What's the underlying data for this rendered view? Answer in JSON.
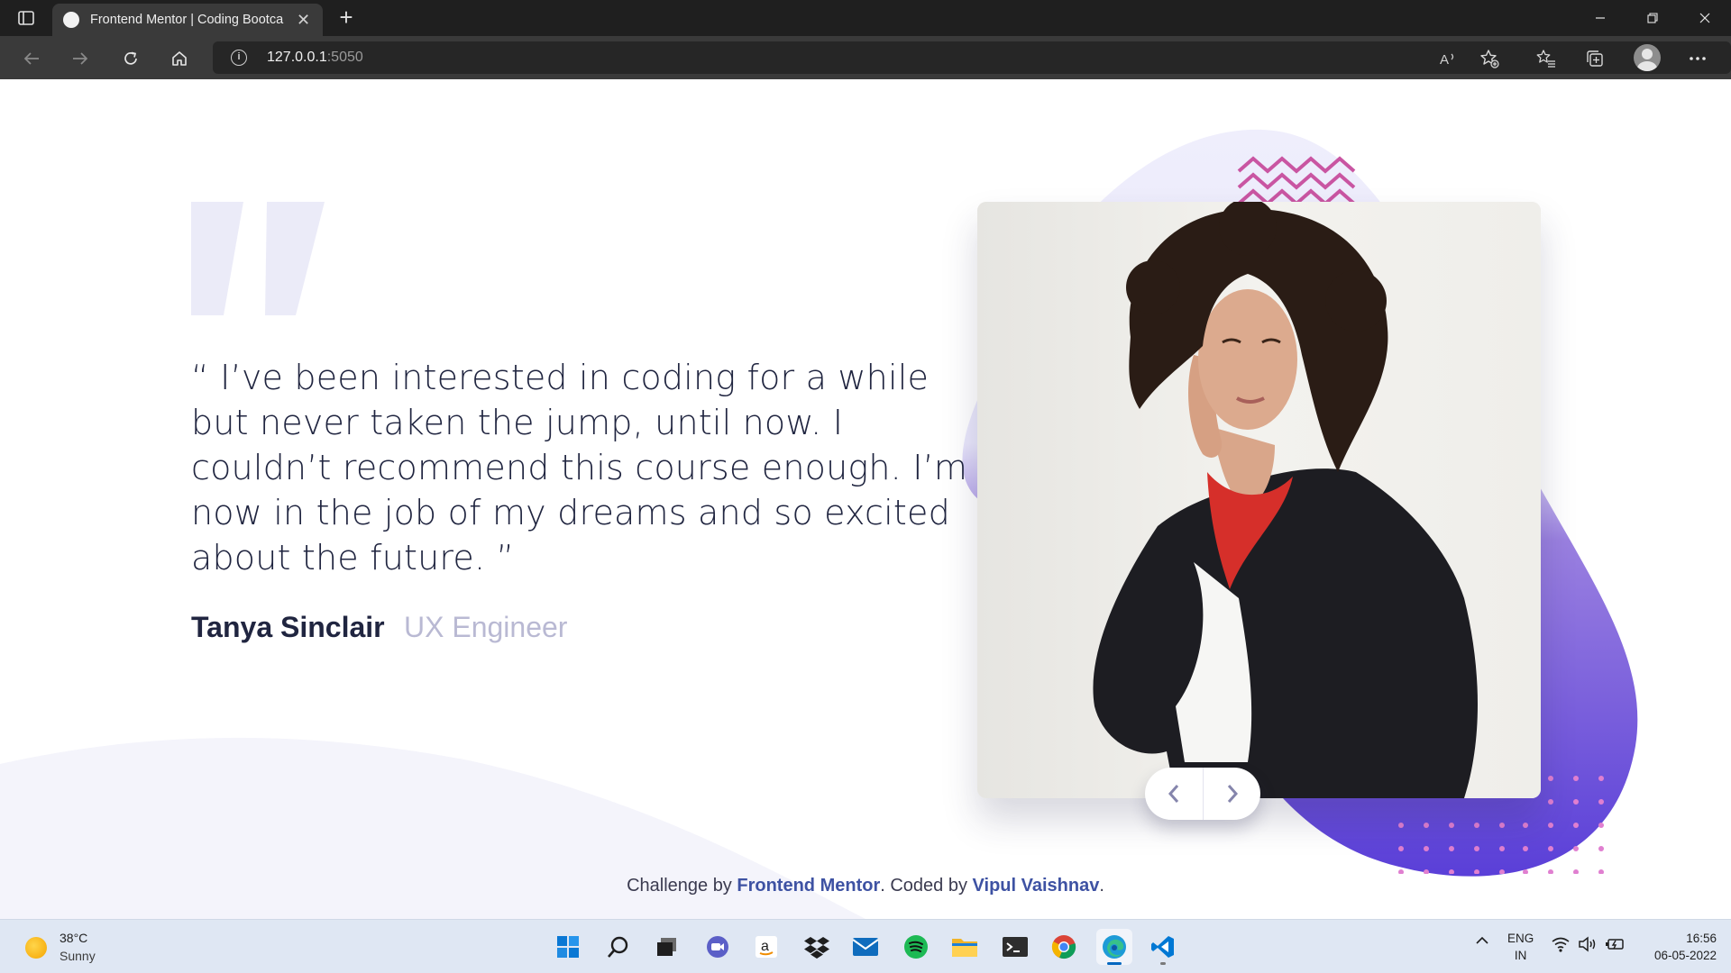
{
  "browser": {
    "tab_title": "Frontend Mentor | Coding Bootcamp Testimonials Slider",
    "address_host": "127.0.0.1",
    "address_port": ":5050"
  },
  "testimonial": {
    "quote": "“ I’ve been interested in coding for a while but never taken the jump, until now. I couldn’t recommend this course enough. I’m now in the job of my dreams and so excited about the future. ”",
    "author_name": "Tanya Sinclair",
    "author_role": "UX Engineer"
  },
  "attribution": {
    "prefix": "Challenge by ",
    "challenge_link": "Frontend Mentor",
    "middle": ". Coded by ",
    "coder_link": "Vipul Vaishnav",
    "suffix": "."
  },
  "colors": {
    "dark_navy": "#202540",
    "grayish_blue": "#b9b9d3",
    "accent_purple": "#6e5bd6",
    "zigzag_pink": "#c955a2",
    "link_blue": "#3e52a3"
  },
  "taskbar": {
    "weather_temp": "38°C",
    "weather_condition": "Sunny",
    "apps": [
      "start-icon",
      "search-icon",
      "task-view-icon",
      "teams-chat-icon",
      "amazon-icon",
      "dropbox-icon",
      "mail-icon",
      "spotify-icon",
      "file-explorer-icon",
      "terminal-icon",
      "chrome-icon",
      "edge-icon",
      "vscode-icon"
    ],
    "lang_1": "ENG",
    "lang_2": "IN",
    "time": "16:56",
    "date": "06-05-2022"
  }
}
